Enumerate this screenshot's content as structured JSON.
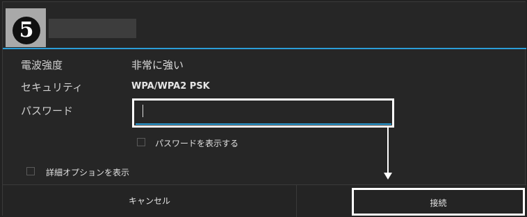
{
  "step_number": "5",
  "network": {
    "ssid": ""
  },
  "rows": {
    "signal": {
      "label": "電波強度",
      "value": "非常に強い"
    },
    "security": {
      "label": "セキュリティ",
      "value": "WPA/WPA2 PSK"
    },
    "password": {
      "label": "パスワード",
      "value": "",
      "placeholder": ""
    }
  },
  "show_password": {
    "label": "パスワードを表示する",
    "checked": false
  },
  "advanced_options": {
    "label": "詳細オプションを表示",
    "checked": false
  },
  "buttons": {
    "cancel": "キャンセル",
    "connect": "接続"
  },
  "colors": {
    "accent": "#2b9ed8",
    "background": "#262626",
    "highlight": "#ffffff"
  }
}
